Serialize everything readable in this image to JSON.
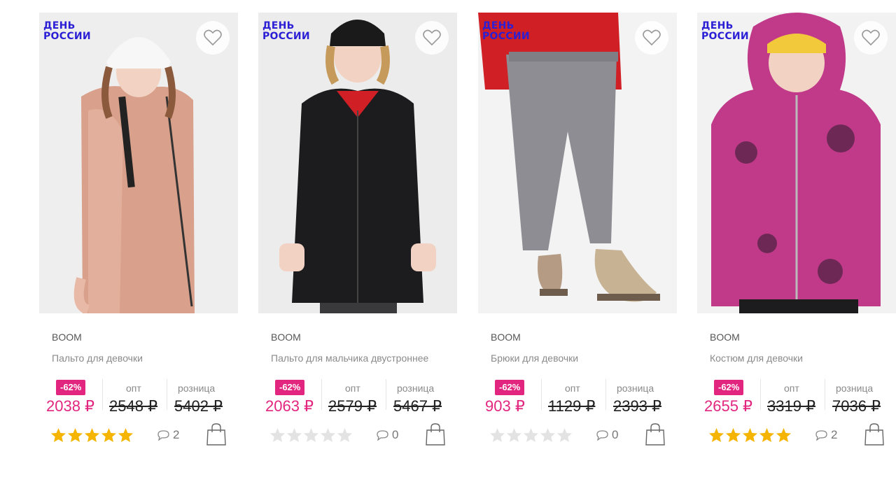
{
  "labels": {
    "opt": "опт",
    "retail": "розница"
  },
  "colors": {
    "accent": "#e2267f",
    "badge": "#2b1fd6",
    "star_on": "#f5b400",
    "star_off": "#e3e3e3"
  },
  "products": [
    {
      "badge_line1": "ДЕНЬ",
      "badge_line2": "РОССИИ",
      "brand": "BOOM",
      "name": "Пальто для девочки",
      "discount": "-62%",
      "price": "2038 ₽",
      "price_opt": "2548 ₽",
      "price_retail": "5402 ₽",
      "rating": 5,
      "comments": "2",
      "image": "girl in pink metallic coat",
      "garment_color": "#d9a08c"
    },
    {
      "badge_line1": "ДЕНЬ",
      "badge_line2": "РОССИИ",
      "brand": "BOOM",
      "name": "Пальто для мальчика двустроннее",
      "discount": "-62%",
      "price": "2063 ₽",
      "price_opt": "2579 ₽",
      "price_retail": "5467 ₽",
      "rating": 0,
      "comments": "0",
      "image": "boy in black long coat",
      "garment_color": "#1c1c1e"
    },
    {
      "badge_line1": "ДЕНЬ",
      "badge_line2": "РОССИИ",
      "brand": "BOOM",
      "name": "Брюки для девочки",
      "discount": "-62%",
      "price": "903 ₽",
      "price_opt": "1129 ₽",
      "price_retail": "2393 ₽",
      "rating": 0,
      "comments": "0",
      "image": "grey winter pants",
      "garment_color": "#8e8d93"
    },
    {
      "badge_line1": "ДЕНЬ",
      "badge_line2": "РОССИИ",
      "brand": "BOOM",
      "name": "Костюм для девочки",
      "discount": "-62%",
      "price": "2655 ₽",
      "price_opt": "3319 ₽",
      "price_retail": "7036 ₽",
      "rating": 5,
      "comments": "2",
      "image": "child in magenta printed jacket",
      "garment_color": "#c13a8a"
    }
  ]
}
